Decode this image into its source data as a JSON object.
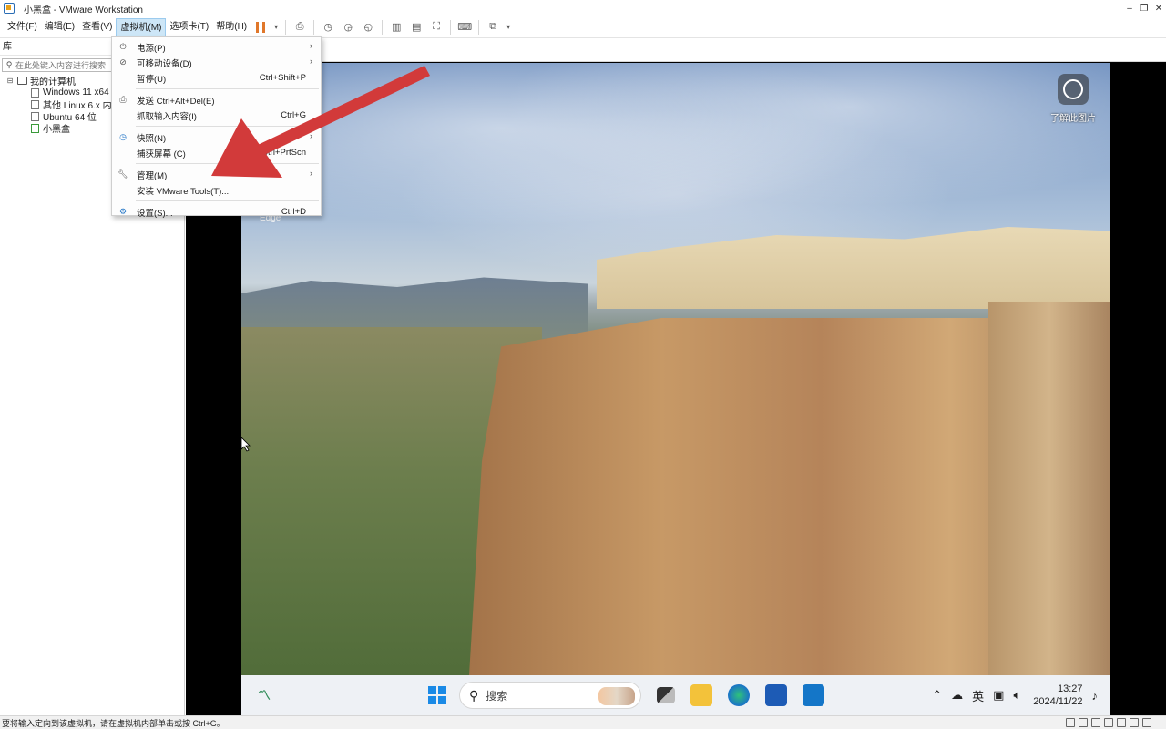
{
  "window": {
    "title": "小黑盒 - VMware Workstation",
    "controls": [
      "–",
      "❐",
      "✕"
    ]
  },
  "menubar": {
    "items": [
      "文件(F)",
      "编辑(E)",
      "查看(V)",
      "虚拟机(M)",
      "选项卡(T)",
      "帮助(H)"
    ],
    "active": "虚拟机(M)"
  },
  "sidebar": {
    "title": "库",
    "search_placeholder": "在此处键入内容进行搜索",
    "root": "我的计算机",
    "vms": [
      "Windows 11 x64",
      "其他 Linux 6.x 内核",
      "Ubuntu 64 位",
      "小黑盒"
    ]
  },
  "vm_menu": {
    "items": [
      {
        "label": "电源(P)",
        "shortcut": "",
        "submenu": true
      },
      {
        "label": "可移动设备(D)",
        "shortcut": "",
        "submenu": true
      },
      {
        "label": "暂停(U)",
        "shortcut": "Ctrl+Shift+P",
        "submenu": false
      },
      {
        "label": "发送 Ctrl+Alt+Del(E)",
        "shortcut": "",
        "submenu": false
      },
      {
        "label": "抓取输入内容(I)",
        "shortcut": "Ctrl+G",
        "submenu": false
      },
      {
        "label": "快照(N)",
        "shortcut": "",
        "submenu": true
      },
      {
        "label": "捕获屏幕 (C)",
        "shortcut": "Ctrl+PrtScn",
        "submenu": false
      },
      {
        "label": "管理(M)",
        "shortcut": "",
        "submenu": true
      },
      {
        "label": "安装 VMware Tools(T)...",
        "shortcut": "",
        "submenu": false
      },
      {
        "label": "设置(S)...",
        "shortcut": "Ctrl+D",
        "submenu": false
      }
    ]
  },
  "desktop": {
    "edge_label": "Edge",
    "learn_pic_label": "了解此图片"
  },
  "taskbar": {
    "search_text": "搜索",
    "ime": "英",
    "time": "13:27",
    "date": "2024/11/22"
  },
  "statusbar": {
    "message": "要将输入定向到该虚拟机，请在虚拟机内部单击或按 Ctrl+G。"
  },
  "colors": {
    "accent": "#1a8ae6",
    "arrow": "#d23a3a",
    "menu_active": "#cde6f7"
  }
}
